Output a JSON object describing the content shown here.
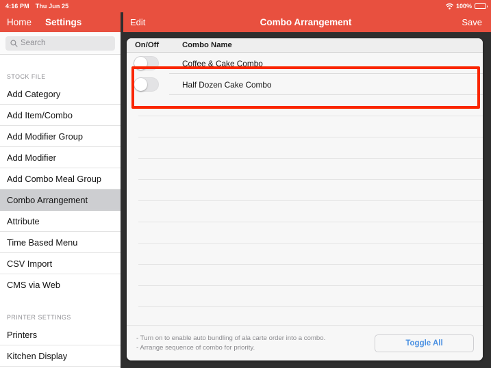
{
  "status_bar": {
    "time": "4:16 PM",
    "date": "Thu Jun 25",
    "battery_percent": "100%",
    "wifi_icon": "wifi-icon",
    "battery_icon": "battery-full-icon"
  },
  "sidebar": {
    "home_label": "Home",
    "title": "Settings",
    "search": {
      "placeholder": "Search",
      "value": "",
      "icon": "search-icon"
    },
    "sections": [
      {
        "header": "STOCK FILE",
        "items": [
          {
            "label": "Add Category",
            "selected": false
          },
          {
            "label": "Add Item/Combo",
            "selected": false
          },
          {
            "label": "Add Modifier Group",
            "selected": false
          },
          {
            "label": "Add Modifier",
            "selected": false
          },
          {
            "label": "Add Combo Meal Group",
            "selected": false
          },
          {
            "label": "Combo Arrangement",
            "selected": true
          },
          {
            "label": "Attribute",
            "selected": false
          },
          {
            "label": "Time Based Menu",
            "selected": false
          },
          {
            "label": "CSV Import",
            "selected": false
          },
          {
            "label": "CMS via Web",
            "selected": false
          }
        ]
      },
      {
        "header": "PRINTER SETTINGS",
        "items": [
          {
            "label": "Printers",
            "selected": false
          },
          {
            "label": "Kitchen Display",
            "selected": false
          }
        ]
      }
    ]
  },
  "navbar": {
    "edit_label": "Edit",
    "title": "Combo Arrangement",
    "save_label": "Save"
  },
  "table": {
    "columns": {
      "on_off": "On/Off",
      "combo_name": "Combo Name"
    },
    "rows": [
      {
        "name": "Coffee & Cake Combo",
        "on": false
      },
      {
        "name": "Half Dozen Cake Combo",
        "on": false
      }
    ],
    "empty_row_count": 11
  },
  "footer": {
    "note_line_1": "- Turn on to enable auto bundling of ala carte order into a combo.",
    "note_line_2": "- Arrange sequence of combo for priority.",
    "toggle_all_label": "Toggle All"
  },
  "annotation": {
    "highlight_color": "#fa2600"
  },
  "colors": {
    "header_red": "#E8503F",
    "accent_blue": "#4a90e2",
    "selected_row": "#cdced1"
  }
}
